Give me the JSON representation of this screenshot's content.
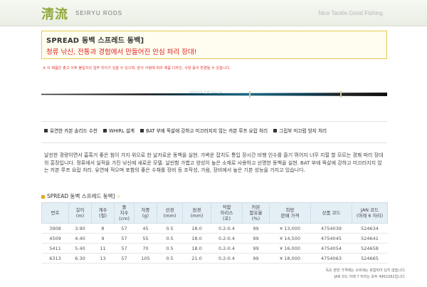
{
  "header": {
    "brand_cn": "淸流",
    "brand_en": "SEIRYU RODS",
    "tagline": "Nice Tackle Good Fishing"
  },
  "product": {
    "title": "SPREAD 동백 스프레드 동백]",
    "subtitle": "청류 낚신, 전통과 경험에서 만들어진 안심 파리 장대!",
    "notice": "※ 이 제품은 출고 이후 불일치의 일부 차이가 있을 수 있으며, 본사 사정에 따라 제품 디자인, 사양 등이 변경될 수 있습니다.",
    "rod_label": "SPREAD 동백 Seiryu"
  },
  "features": [
    "유연한 카본 솔리드 수천",
    "WHIRL 설계",
    "BAT 부에 뚝살에 강하고 미끄러지지 않는 카본 루프 요랍 처리",
    "그립부 미끄럼 방지 처리"
  ],
  "description": "날씬한 경량이면서 흠혹거 좋은 힘이 가지 위으로 한 날카로운 동백을 실현. 가벼운 잡치도 통입 장시간 비행 인수를 즐기 뛰어지 너무 지절 할 모르는 경쾌 파리 장대의 흥장입니다. 정류에서 실적을 가진 낚신에 새로운 모델. 날씬함 가볍고 양성이 높은 소재로 사용하고 선명한 동백을 실현. BAT 부에 뚝살에 강하고 미끄러지지 않는 카본 루프 요랍 처리. 유연에 적으며 포함의 좋은 수채를 장비 등 조작성, 가음, 장비에서 높은 기본 성능을 가지고 있습니다.",
  "spec": {
    "section_title": "SPREAD 동백 스프레드 동백]",
    "star": "☆",
    "headers": [
      "번호",
      "길이\n(m)",
      "계수\n(절)",
      "폴\n치수\n(cm)",
      "자중\n(g)",
      "선경\n(mm)",
      "원경\n(mm)",
      "적합\n하리스\n(호)",
      "카본\n함유율\n(%)",
      "희망\n판매 가격",
      "상품 코드",
      "JAN 코드\n(아래 6 자리)"
    ],
    "rows": [
      [
        "3908",
        "3.90",
        "8",
        "57",
        "45",
        "0.5",
        "18.0",
        "0.2-0.4",
        "99",
        "¥ 13,000",
        "4754039",
        "524634"
      ],
      [
        "4509",
        "4.40",
        "9",
        "57",
        "55",
        "0.5",
        "18.0",
        "0.2-0.4",
        "99",
        "¥ 14,500",
        "4754045",
        "524641"
      ],
      [
        "5411",
        "5.40",
        "11",
        "57",
        "70",
        "0.5",
        "18.0",
        "0.2-0.4",
        "99",
        "¥ 16,000",
        "4754054",
        "524658"
      ],
      [
        "6313",
        "6.30",
        "13",
        "57",
        "105",
        "0.5",
        "21.0",
        "0.2-0.4",
        "99",
        "¥ 18,000",
        "4754063",
        "524665"
      ]
    ]
  },
  "watermark": {
    "line1": "독도 본한 가격에는 소비세는 포함되어 있지 않습니다.",
    "line2": "JAN 코드 아래 7 자리는 모두 4952262입니다."
  }
}
